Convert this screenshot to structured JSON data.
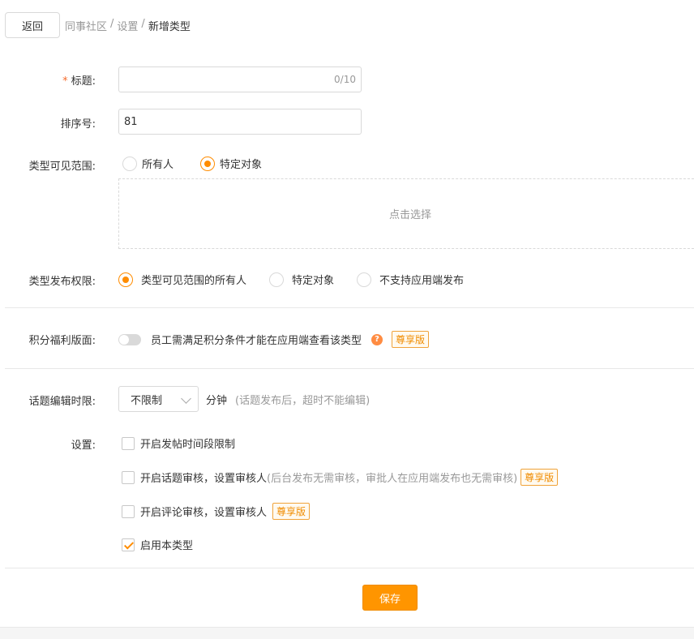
{
  "header": {
    "back_label": "返回",
    "breadcrumb": [
      "同事社区",
      "设置",
      "新增类型"
    ],
    "separator": "/"
  },
  "form": {
    "title": {
      "required_mark": "*",
      "label": "标题:",
      "value": "",
      "counter": "0/10"
    },
    "sort": {
      "label": "排序号:",
      "value": "81"
    },
    "visibility": {
      "label": "类型可见范围:",
      "options": [
        "所有人",
        "特定对象"
      ],
      "selected": "特定对象",
      "select_placeholder": "点击选择"
    },
    "publish_permission": {
      "label": "类型发布权限:",
      "options": [
        "类型可见范围的所有人",
        "特定对象",
        "不支持应用端发布"
      ],
      "selected": "类型可见范围的所有人"
    },
    "points_page": {
      "label": "积分福利版面:",
      "switch_on": false,
      "text": "员工需满足积分条件才能在应用端查看该类型",
      "help_icon": "?",
      "badge": "尊享版"
    },
    "edit_time_limit": {
      "label": "话题编辑时限:",
      "value": "不限制",
      "unit": "分钟",
      "hint": "(话题发布后，超时不能编辑)"
    },
    "settings": {
      "label": "设置:",
      "items": [
        {
          "text": "开启发帖时间段限制",
          "hint": "",
          "checked": false,
          "badge": ""
        },
        {
          "text": "开启话题审核，设置审核人",
          "hint": "(后台发布无需审核，审批人在应用端发布也无需审核)",
          "checked": false,
          "badge": "尊享版"
        },
        {
          "text": "开启评论审核，设置审核人",
          "hint": "",
          "checked": false,
          "badge": "尊享版"
        },
        {
          "text": "启用本类型",
          "hint": "",
          "checked": true,
          "badge": ""
        }
      ]
    }
  },
  "save_label": "保存",
  "colors": {
    "accent": "#ff9500",
    "required": "#f56c2d",
    "badge_border": "#f0a33a",
    "muted_text": "#999999"
  }
}
